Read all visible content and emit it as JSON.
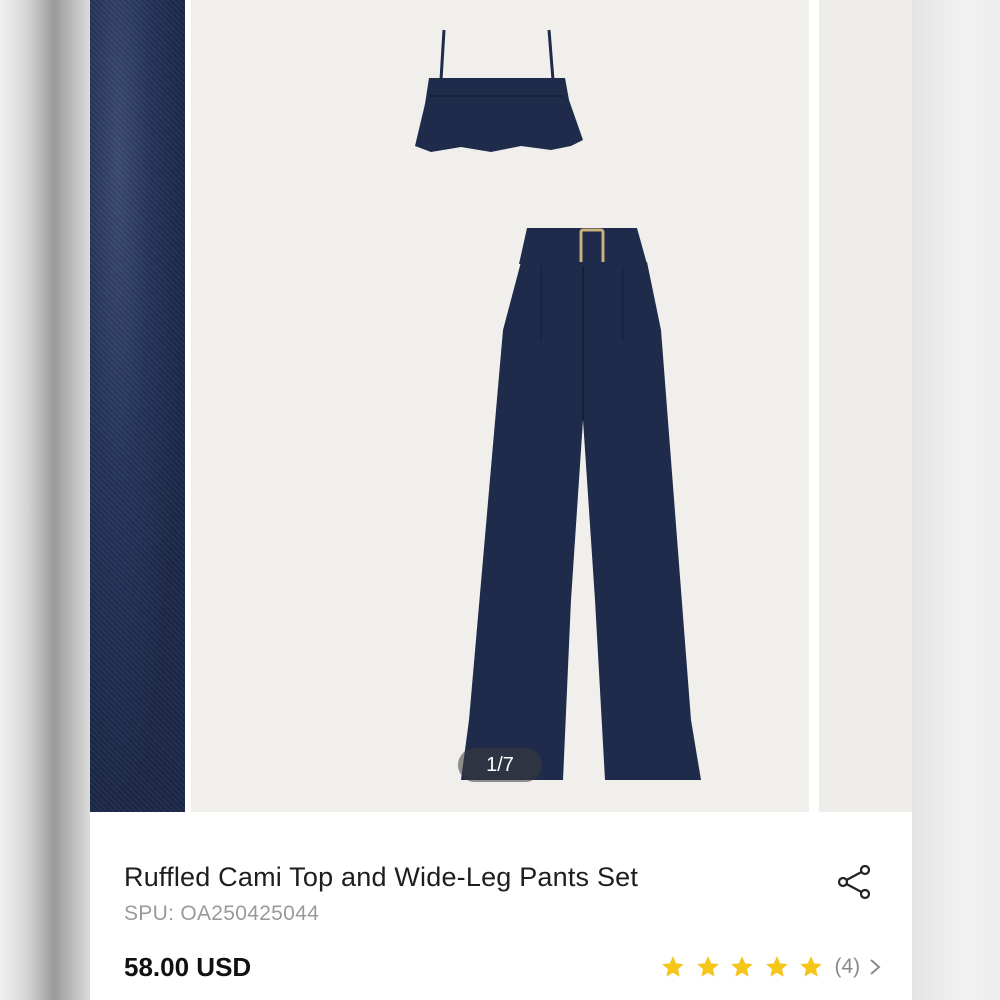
{
  "carousel": {
    "counter": "1/7"
  },
  "product": {
    "title": "Ruffled Cami Top and Wide-Leg Pants Set",
    "spu": "SPU: OA250425044",
    "price": "58.00 USD",
    "rating_stars": 5,
    "review_count": "(4)"
  },
  "colors": {
    "navy": "#1f2b4b",
    "star": "#f5c518",
    "backdrop": "#f1efec"
  },
  "icons": {
    "share": "share-icon",
    "star": "star-icon",
    "chevron": "chevron-right-icon"
  }
}
